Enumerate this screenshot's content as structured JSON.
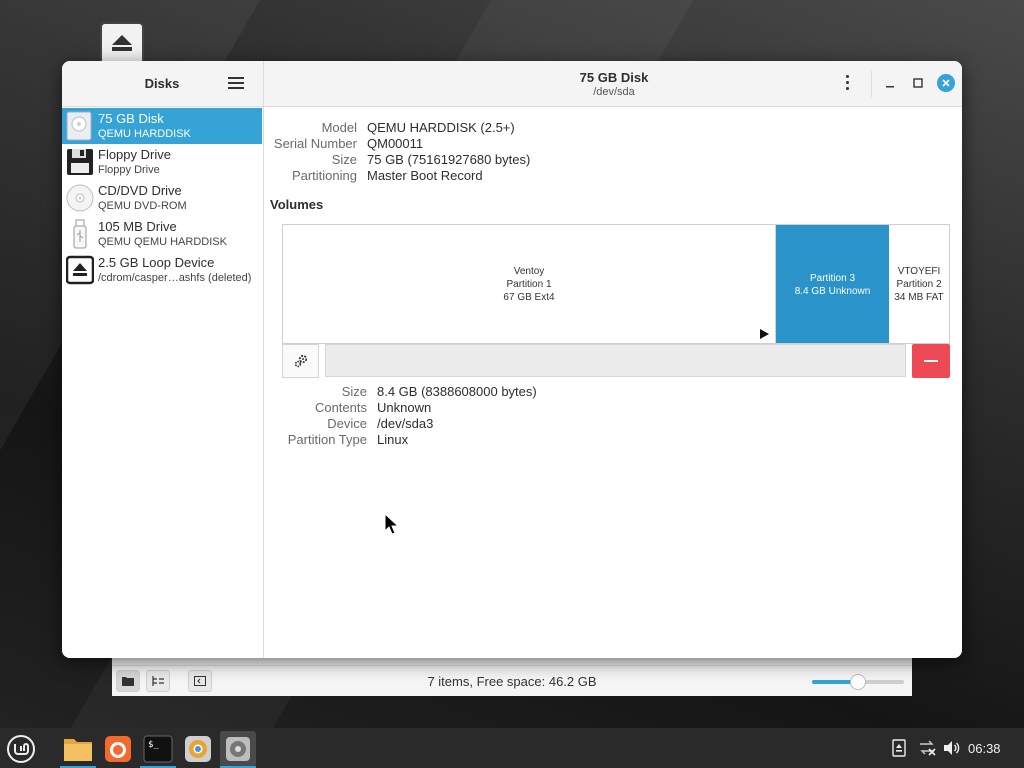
{
  "app": {
    "sidebar_title": "Disks",
    "header_title": "75 GB Disk",
    "header_subtitle": "/dev/sda"
  },
  "devices": [
    {
      "name": "75 GB Disk",
      "sub": "QEMU HARDDISK",
      "icon": "hard-disk-icon",
      "selected": true
    },
    {
      "name": "Floppy Drive",
      "sub": "Floppy Drive",
      "icon": "floppy-icon",
      "selected": false
    },
    {
      "name": "CD/DVD Drive",
      "sub": "QEMU DVD-ROM",
      "icon": "optical-disc-icon",
      "selected": false
    },
    {
      "name": "105 MB Drive",
      "sub": "QEMU QEMU HARDDISK",
      "icon": "usb-drive-icon",
      "selected": false
    },
    {
      "name": "2.5 GB Loop Device",
      "sub": "/cdrom/casper…ashfs (deleted)",
      "icon": "eject-icon",
      "selected": false
    }
  ],
  "disk_info": [
    {
      "key": "Model",
      "value": "QEMU HARDDISK (2.5+)"
    },
    {
      "key": "Serial Number",
      "value": "QM00011"
    },
    {
      "key": "Size",
      "value": "75 GB (75161927680 bytes)"
    },
    {
      "key": "Partitioning",
      "value": "Master Boot Record"
    }
  ],
  "volumes": {
    "title": "Volumes",
    "partitions": [
      {
        "line1": "Ventoy",
        "line2": "Partition 1",
        "line3": "67 GB Ext4",
        "selected": false
      },
      {
        "line1": "Partition 3",
        "line2": "8.4 GB Unknown",
        "line3": "",
        "selected": true
      },
      {
        "line1": "VTOYEFI",
        "line2": "Partition 2",
        "line3": "34 MB FAT",
        "selected": false
      }
    ]
  },
  "partition_info": [
    {
      "key": "Size",
      "value": "8.4 GB (8388608000 bytes)"
    },
    {
      "key": "Contents",
      "value": "Unknown"
    },
    {
      "key": "Device",
      "value": "/dev/sda3"
    },
    {
      "key": "Partition Type",
      "value": "Linux"
    }
  ],
  "file_manager": {
    "status": "7 items, Free space: 46.2 GB",
    "zoom_level_fraction": 0.5
  },
  "taskbar": {
    "clock": "06:38",
    "apps": [
      "files-icon",
      "firefox-icon",
      "terminal-icon",
      "chromium-icon",
      "disks-icon"
    ]
  },
  "colors": {
    "accent": "#35a3d6",
    "selected_partition": "#2a93c9",
    "delete": "#ee4a55"
  }
}
